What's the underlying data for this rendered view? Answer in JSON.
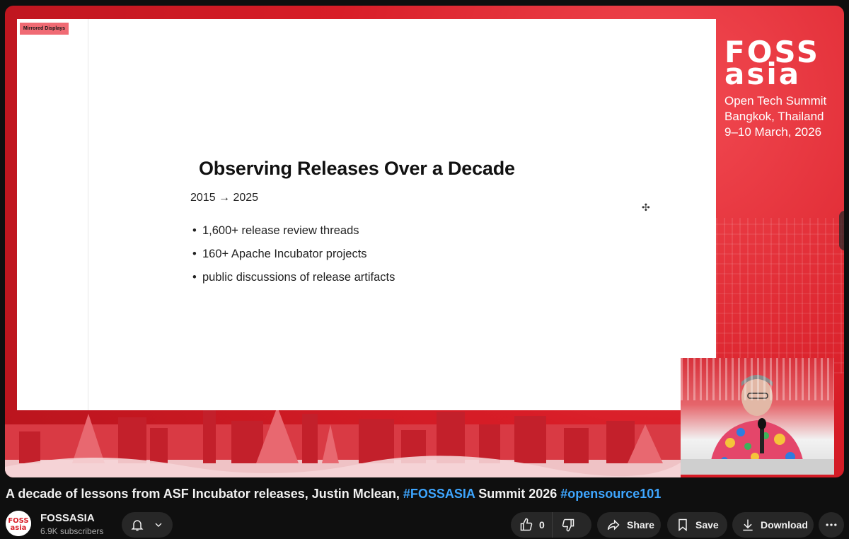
{
  "video": {
    "slide": {
      "mirrored_tag": "Mirrored Displays",
      "title": "Observing Releases Over a Decade",
      "subtitle": "2015 → 2025",
      "bullets": [
        "1,600+ release review threads",
        "160+ Apache Incubator projects",
        "public discussions of release artifacts"
      ]
    },
    "branding": {
      "logo_line1": "FOSS",
      "logo_line2": "asia",
      "event": "Open Tech Summit",
      "location": "Bangkok, Thailand",
      "dates": "9–10 March, 2026"
    },
    "colors": {
      "accent": "#d81d27",
      "slide_bg": "#ffffff"
    }
  },
  "title": {
    "prefix": "A decade of lessons from ASF Incubator releases, Justin Mclean, ",
    "hashtag1": "#FOSSASIA",
    "middle": " Summit 2026 ",
    "hashtag2": "#opensource101"
  },
  "channel": {
    "avatar_logo_line1": "FOSS",
    "avatar_logo_line2": "asia",
    "name": "FOSSASIA",
    "subscribers": "6.9K subscribers"
  },
  "actions": {
    "like_count": "0",
    "share": "Share",
    "save": "Save",
    "download": "Download",
    "icons": [
      "bell-icon",
      "chevron-down-icon",
      "thumbs-up-icon",
      "thumbs-down-icon",
      "share-icon",
      "bookmark-icon",
      "download-icon",
      "more-icon"
    ]
  }
}
